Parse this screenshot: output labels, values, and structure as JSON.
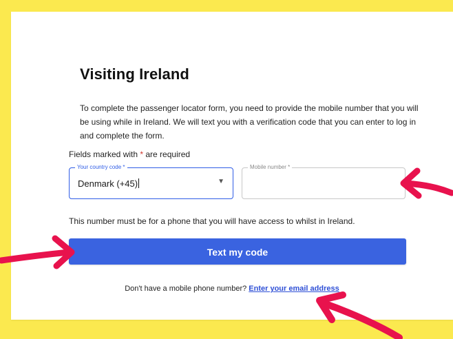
{
  "form": {
    "title": "Visiting Ireland",
    "intro": "To complete the passenger locator form, you need to provide the mobile number that you will be using while in Ireland. We will text you with a verification code that you can enter to log in and complete the form.",
    "required_note_before": "Fields marked with ",
    "required_note_star": "*",
    "required_note_after": " are required",
    "country_field": {
      "label": "Your country code *",
      "value": "Denmark (+45)",
      "dropdown_icon": "chevron-down-icon"
    },
    "mobile_field": {
      "label": "Mobile number *",
      "value": ""
    },
    "phone_note": "This number must be for a phone that you will have access to whilst in Ireland.",
    "submit_label": "Text my code",
    "alt_text": "Don't have a mobile phone number?",
    "alt_link": "Enter your email address"
  },
  "colors": {
    "background": "#fbe94f",
    "accent": "#3a63e0",
    "arrow": "#e8124d"
  }
}
